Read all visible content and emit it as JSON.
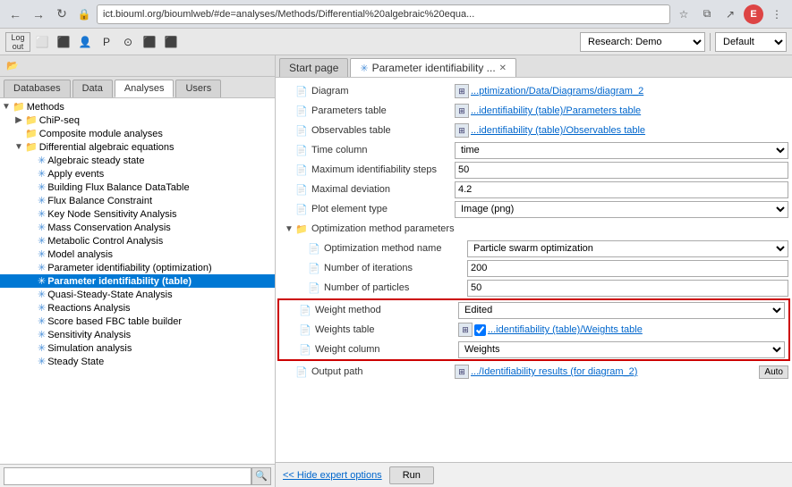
{
  "browser": {
    "back_icon": "←",
    "forward_icon": "→",
    "refresh_icon": "↻",
    "address": "ict.biouml.org/bioumlweb/#de=analyses/Methods/Differential%20algebraic%20equa...",
    "profile_label": "E",
    "menu_icon": "⋮"
  },
  "toolbar": {
    "research_label": "Research: Demo",
    "default_label": "Default",
    "icons": [
      "🗒",
      "⬛",
      "⬛",
      "⬛",
      "P",
      "⭕",
      "⬛",
      "⬛"
    ]
  },
  "left_panel": {
    "tabs": [
      {
        "label": "Databases",
        "active": false
      },
      {
        "label": "Data",
        "active": false
      },
      {
        "label": "Analyses",
        "active": true
      },
      {
        "label": "Users",
        "active": false
      }
    ],
    "tree": [
      {
        "id": "methods",
        "label": "Methods",
        "indent": 0,
        "expand": "▼",
        "icon": "folder",
        "type": "folder"
      },
      {
        "id": "chip-seq",
        "label": "ChiP-seq",
        "indent": 1,
        "expand": "▶",
        "icon": "folder",
        "type": "folder"
      },
      {
        "id": "composite",
        "label": "Composite module analyses",
        "indent": 1,
        "expand": " ",
        "icon": "folder",
        "type": "folder"
      },
      {
        "id": "diff-alg",
        "label": "Differential algebraic equations",
        "indent": 1,
        "expand": "▼",
        "icon": "folder",
        "type": "folder"
      },
      {
        "id": "alg-steady",
        "label": "Algebraic steady state",
        "indent": 2,
        "expand": " ",
        "icon": "gear",
        "type": "item"
      },
      {
        "id": "apply-events",
        "label": "Apply events",
        "indent": 2,
        "expand": " ",
        "icon": "gear",
        "type": "item"
      },
      {
        "id": "building-flux",
        "label": "Building Flux Balance DataTable",
        "indent": 2,
        "expand": " ",
        "icon": "gear",
        "type": "item"
      },
      {
        "id": "flux-balance",
        "label": "Flux Balance Constraint",
        "indent": 2,
        "expand": " ",
        "icon": "gear",
        "type": "item"
      },
      {
        "id": "key-node",
        "label": "Key Node Sensitivity Analysis",
        "indent": 2,
        "expand": " ",
        "icon": "gear",
        "type": "item"
      },
      {
        "id": "mass-conservation",
        "label": "Mass Conservation Analysis",
        "indent": 2,
        "expand": " ",
        "icon": "gear",
        "type": "item"
      },
      {
        "id": "metabolic-control",
        "label": "Metabolic Control Analysis",
        "indent": 2,
        "expand": " ",
        "icon": "gear",
        "type": "item"
      },
      {
        "id": "model-analysis",
        "label": "Model analysis",
        "indent": 2,
        "expand": " ",
        "icon": "gear",
        "type": "item"
      },
      {
        "id": "param-ident-opt",
        "label": "Parameter identifiability (optimization)",
        "indent": 2,
        "expand": " ",
        "icon": "gear",
        "type": "item"
      },
      {
        "id": "param-ident-table",
        "label": "Parameter identifiability (table)",
        "indent": 2,
        "expand": " ",
        "icon": "gear",
        "type": "item",
        "selected": true
      },
      {
        "id": "quasi-steady",
        "label": "Quasi-Steady-State Analysis",
        "indent": 2,
        "expand": " ",
        "icon": "gear",
        "type": "item"
      },
      {
        "id": "reactions-analysis",
        "label": "Reactions Analysis",
        "indent": 2,
        "expand": " ",
        "icon": "gear",
        "type": "item"
      },
      {
        "id": "score-fbc",
        "label": "Score based FBC table builder",
        "indent": 2,
        "expand": " ",
        "icon": "gear",
        "type": "item"
      },
      {
        "id": "sensitivity",
        "label": "Sensitivity Analysis",
        "indent": 2,
        "expand": " ",
        "icon": "gear",
        "type": "item"
      },
      {
        "id": "simulation",
        "label": "Simulation analysis",
        "indent": 2,
        "expand": " ",
        "icon": "gear",
        "type": "item"
      },
      {
        "id": "steady-state",
        "label": "Steady State",
        "indent": 2,
        "expand": " ",
        "icon": "gear",
        "type": "item"
      }
    ],
    "search_placeholder": ""
  },
  "right_panel": {
    "tabs": [
      {
        "label": "Start page",
        "active": false,
        "closeable": false
      },
      {
        "label": "Parameter identifiability ...",
        "active": true,
        "closeable": true
      }
    ],
    "form_rows": [
      {
        "id": "diagram",
        "indent": 0,
        "expand": " ",
        "icon": "doc",
        "label": "Diagram",
        "value_type": "link",
        "link_text": "...ptimization/Data/Diagrams/diagram_2",
        "has_link_icon": true
      },
      {
        "id": "parameters-table",
        "indent": 0,
        "expand": " ",
        "icon": "doc",
        "label": "Parameters table",
        "value_type": "link",
        "link_text": "...identifiability (table)/Parameters table",
        "has_link_icon": true
      },
      {
        "id": "observables-table",
        "indent": 0,
        "expand": " ",
        "icon": "doc",
        "label": "Observables table",
        "value_type": "link",
        "link_text": "...identifiability (table)/Observables table",
        "has_link_icon": true
      },
      {
        "id": "time-column",
        "indent": 0,
        "expand": " ",
        "icon": "doc",
        "label": "Time column",
        "value_type": "select",
        "select_value": "time"
      },
      {
        "id": "max-ident-steps",
        "indent": 0,
        "expand": " ",
        "icon": "doc",
        "label": "Maximum identifiability steps",
        "value_type": "text",
        "text_value": "50"
      },
      {
        "id": "maximal-deviation",
        "indent": 0,
        "expand": " ",
        "icon": "doc",
        "label": "Maximal deviation",
        "value_type": "text",
        "text_value": "4.2"
      },
      {
        "id": "plot-element-type",
        "indent": 0,
        "expand": " ",
        "icon": "doc",
        "label": "Plot element type",
        "value_type": "select",
        "select_value": "Image (png)"
      },
      {
        "id": "opt-method-params",
        "indent": 0,
        "expand": "▼",
        "icon": "folder",
        "label": "Optimization method parameters",
        "value_type": "none"
      },
      {
        "id": "opt-method-name",
        "indent": 1,
        "expand": " ",
        "icon": "doc",
        "label": "Optimization method name",
        "value_type": "select",
        "select_value": "Particle swarm optimization"
      },
      {
        "id": "num-iterations",
        "indent": 1,
        "expand": " ",
        "icon": "doc",
        "label": "Number of iterations",
        "value_type": "text",
        "text_value": "200"
      },
      {
        "id": "num-particles",
        "indent": 1,
        "expand": " ",
        "icon": "doc",
        "label": "Number of particles",
        "value_type": "text",
        "text_value": "50"
      }
    ],
    "highlighted_rows": [
      {
        "id": "weight-method",
        "indent": 0,
        "expand": " ",
        "icon": "doc",
        "label": "Weight method",
        "value_type": "select",
        "select_value": "Edited"
      },
      {
        "id": "weights-table",
        "indent": 0,
        "expand": " ",
        "icon": "doc",
        "label": "Weights table",
        "value_type": "link_check",
        "link_text": "...identifiability (table)/Weights table",
        "has_link_icon": true,
        "checked": true
      },
      {
        "id": "weight-column",
        "indent": 0,
        "expand": " ",
        "icon": "doc",
        "label": "Weight column",
        "value_type": "select",
        "select_value": "Weights"
      }
    ],
    "output_row": {
      "id": "output-path",
      "indent": 0,
      "expand": " ",
      "icon": "doc",
      "label": "Output path",
      "value_type": "link_auto",
      "link_text": ".../Identifiability results (for diagram_2)",
      "has_link_icon": true,
      "auto_label": "Auto"
    },
    "bottom": {
      "hide_label": "<< Hide expert options",
      "run_label": "Run"
    }
  }
}
